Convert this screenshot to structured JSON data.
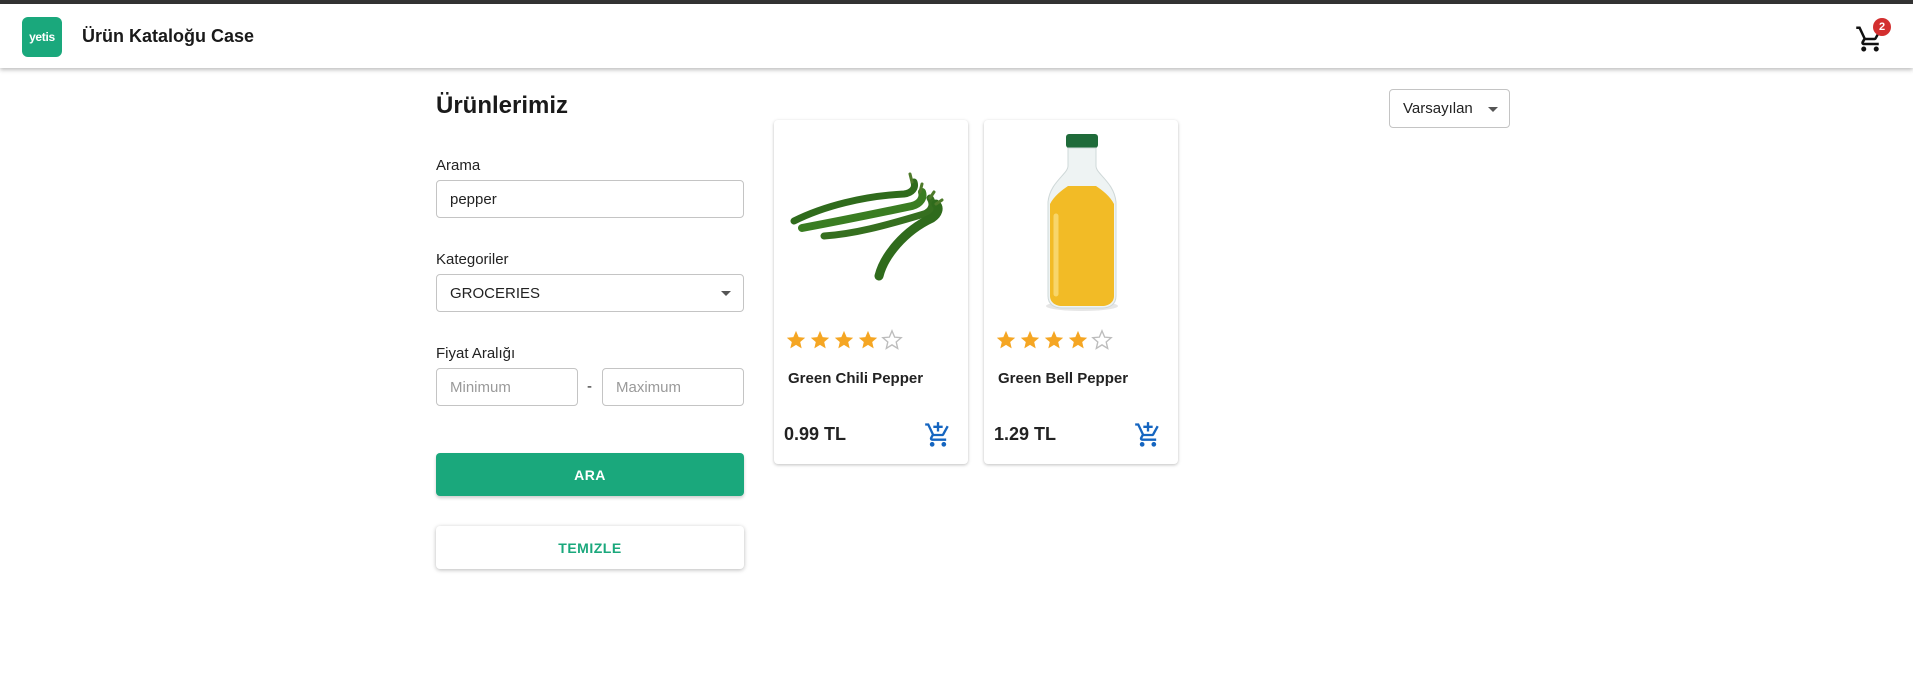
{
  "app": {
    "logo_text": "yetis",
    "title": "Ürün Kataloğu Case",
    "cart_icon": "shopping-cart-icon",
    "cart_count": "2",
    "brand_color": "#1aa87c"
  },
  "page": {
    "title": "Ürünlerimiz"
  },
  "filters": {
    "search": {
      "label": "Arama",
      "value": "pepper"
    },
    "category": {
      "label": "Kategoriler",
      "value": "GROCERIES"
    },
    "price_range": {
      "label": "Fiyat Aralığı",
      "min_placeholder": "Minimum",
      "max_placeholder": "Maximum",
      "separator": "-"
    },
    "search_button": "ARA",
    "clear_button": "TEMIZLE"
  },
  "sort": {
    "value": "Varsayılan"
  },
  "products": [
    {
      "name": "Green Chili Pepper",
      "price": "0.99 TL",
      "rating": 4,
      "max_rating": 5,
      "image_icon": "green-chili-pepper-image"
    },
    {
      "name": "Green Bell Pepper",
      "price": "1.29 TL",
      "rating": 4,
      "max_rating": 5,
      "image_icon": "juice-bottle-image"
    }
  ],
  "colors": {
    "star": "#f5a623",
    "star_empty": "#bdbdbd",
    "add_cart": "#1565c0",
    "badge": "#d32f2f"
  }
}
